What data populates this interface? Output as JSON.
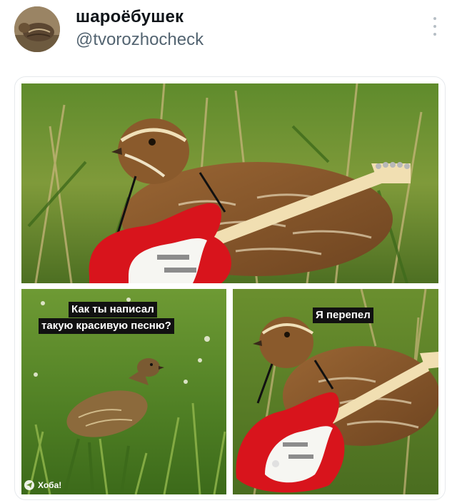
{
  "post": {
    "display_name": "шароёбушек",
    "handle": "@tvorozhocheck",
    "more_icon": "vertical-ellipsis-icon"
  },
  "meme": {
    "top_panel": {
      "subject": "quail with red electric guitar"
    },
    "bottom_left_panel": {
      "caption_line1": "Как ты написал",
      "caption_line2": "такую красивую песню?",
      "watermark": "Хоба!"
    },
    "bottom_right_panel": {
      "caption": "Я перепел"
    }
  },
  "colors": {
    "guitar_red": "#d8141c",
    "grass_green": "#5e8a2a",
    "quail_brown": "#8a5a2c"
  }
}
